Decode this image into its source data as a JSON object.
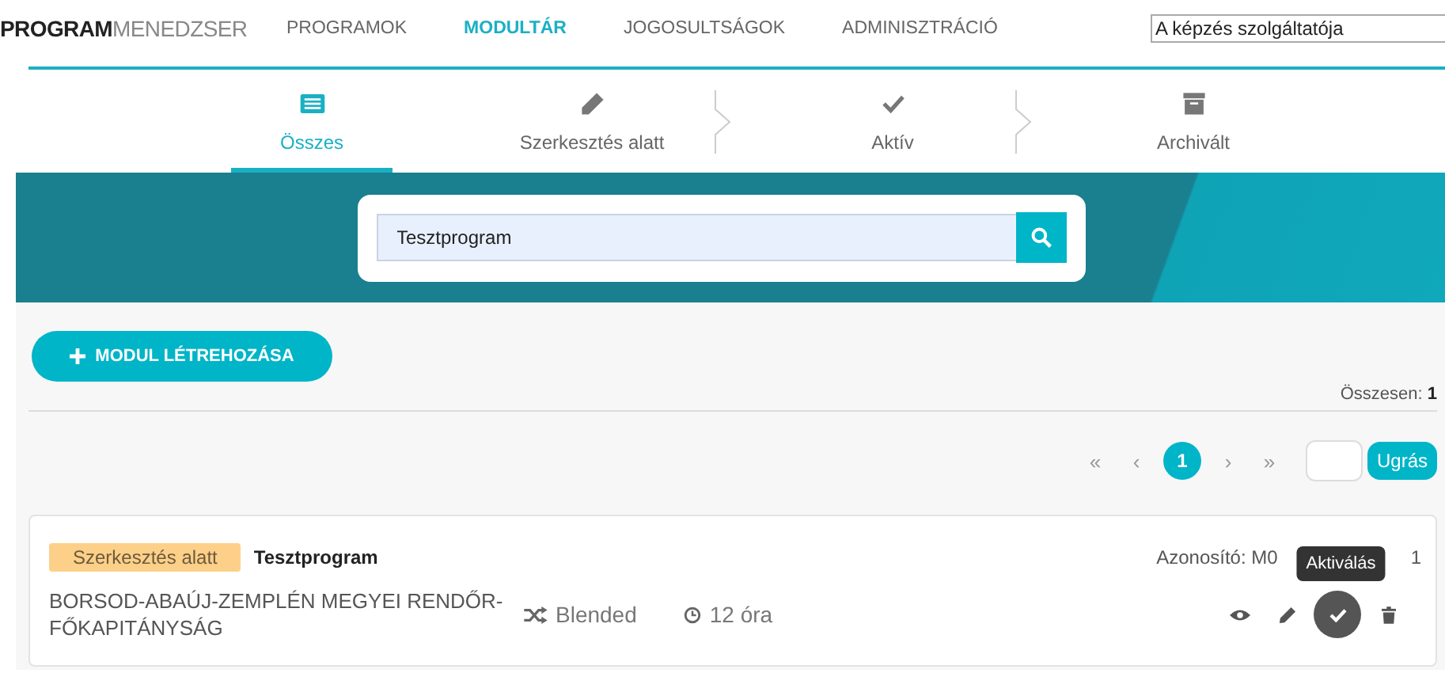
{
  "nav": {
    "brand_bold": "PROGRAM",
    "brand_light": "MENEDZSER",
    "items": [
      {
        "label": "PROGRAMOK",
        "selected": false
      },
      {
        "label": "MODULTÁR",
        "selected": true
      },
      {
        "label": "JOGOSULTSÁGOK",
        "selected": false
      },
      {
        "label": "ADMINISZTRÁCIÓ",
        "selected": false
      }
    ],
    "provider_field": {
      "placeholder": "A képzés szolgáltatója"
    }
  },
  "status_tabs": [
    {
      "label": "Összes",
      "kind": "list",
      "selected": true
    },
    {
      "label": "Szerkesztés alatt",
      "kind": "pencil",
      "selected": false
    },
    {
      "label": "Aktív",
      "kind": "check",
      "selected": false
    },
    {
      "label": "Archivált",
      "kind": "archive",
      "selected": false
    }
  ],
  "search": {
    "value": "Tesztprogram"
  },
  "create_button": {
    "label": "MODUL LÉTREHOZÁSA"
  },
  "total": {
    "label": "Összesen:",
    "value": "1"
  },
  "pagination": {
    "first": "«",
    "prev": "‹",
    "pages": [
      {
        "label": "1",
        "selected": true
      }
    ],
    "next": "›",
    "last": "»",
    "goto_button": "Ugrás"
  },
  "modules": [
    {
      "status": "Szerkesztés alatt",
      "title": "Tesztprogram",
      "organization": "BORSOD-ABAÚJ-ZEMPLÉN MEGYEI RENDŐR-FŐKAPITÁNYSÁG",
      "delivery": "Blended",
      "duration": "12 óra",
      "id_label": "Azonosító: M0",
      "id_tail": "1",
      "actions": [
        {
          "kind": "view",
          "hovered": false
        },
        {
          "kind": "edit",
          "hovered": false
        },
        {
          "kind": "activate",
          "hovered": true,
          "tooltip": "Aktiválás"
        },
        {
          "kind": "delete",
          "hovered": false
        }
      ]
    }
  ]
}
